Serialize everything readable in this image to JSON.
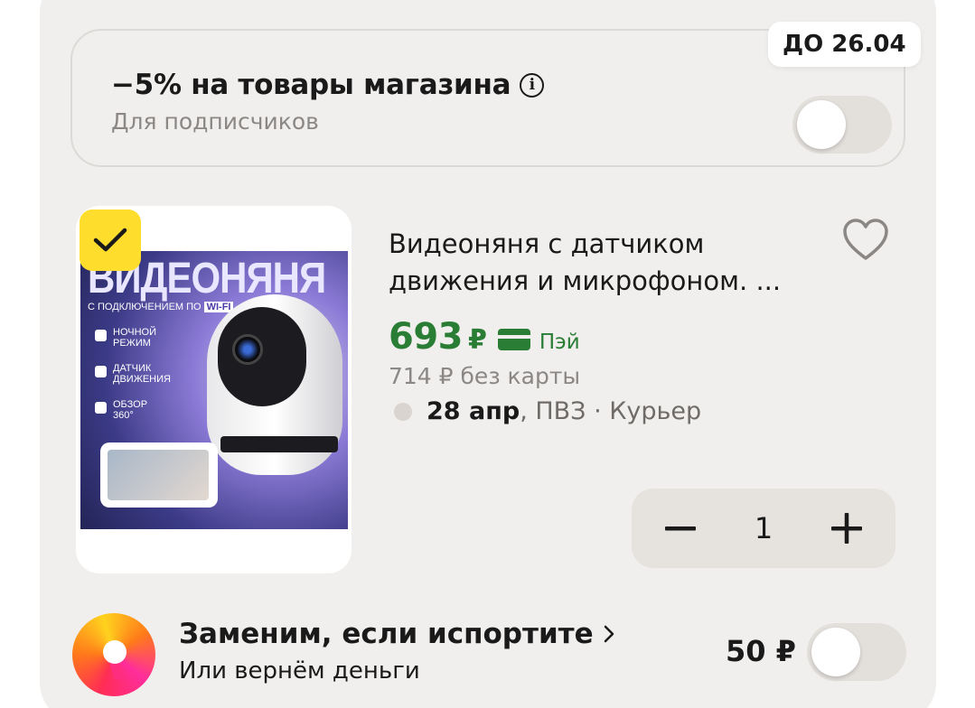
{
  "promo": {
    "title": "−5% на товары магазина",
    "subtitle": "Для подписчиков",
    "badge": "ДО 26.04",
    "toggle_on": false
  },
  "product": {
    "selected": true,
    "image": {
      "title": "ВИДЕОНЯНЯ",
      "subtitle": "С ПОДКЛЮЧЕНИЕМ ПО",
      "wifi": "WI-FI",
      "features": [
        "НОЧНОЙ РЕЖИМ",
        "ДАТЧИК ДВИЖЕНИЯ",
        "ОБЗОР 360°"
      ]
    },
    "title_line1": "Видеоняня с датчиком",
    "title_line2": "движения и микрофоном. ...",
    "price": "693",
    "currency": "₽",
    "pay_label": "Пэй",
    "old_price": "714 ₽  без карты",
    "delivery_date": "28 апр",
    "delivery_rest": ", ПВЗ · Курьер",
    "quantity": "1"
  },
  "insurance": {
    "title": "Заменим, если испортите",
    "subtitle": "Или вернём деньги",
    "price": "50 ₽",
    "toggle_on": false
  },
  "colors": {
    "accent_green": "#2a7d35",
    "check_yellow": "#ffdd2d",
    "panel_bg": "#f1efed"
  }
}
